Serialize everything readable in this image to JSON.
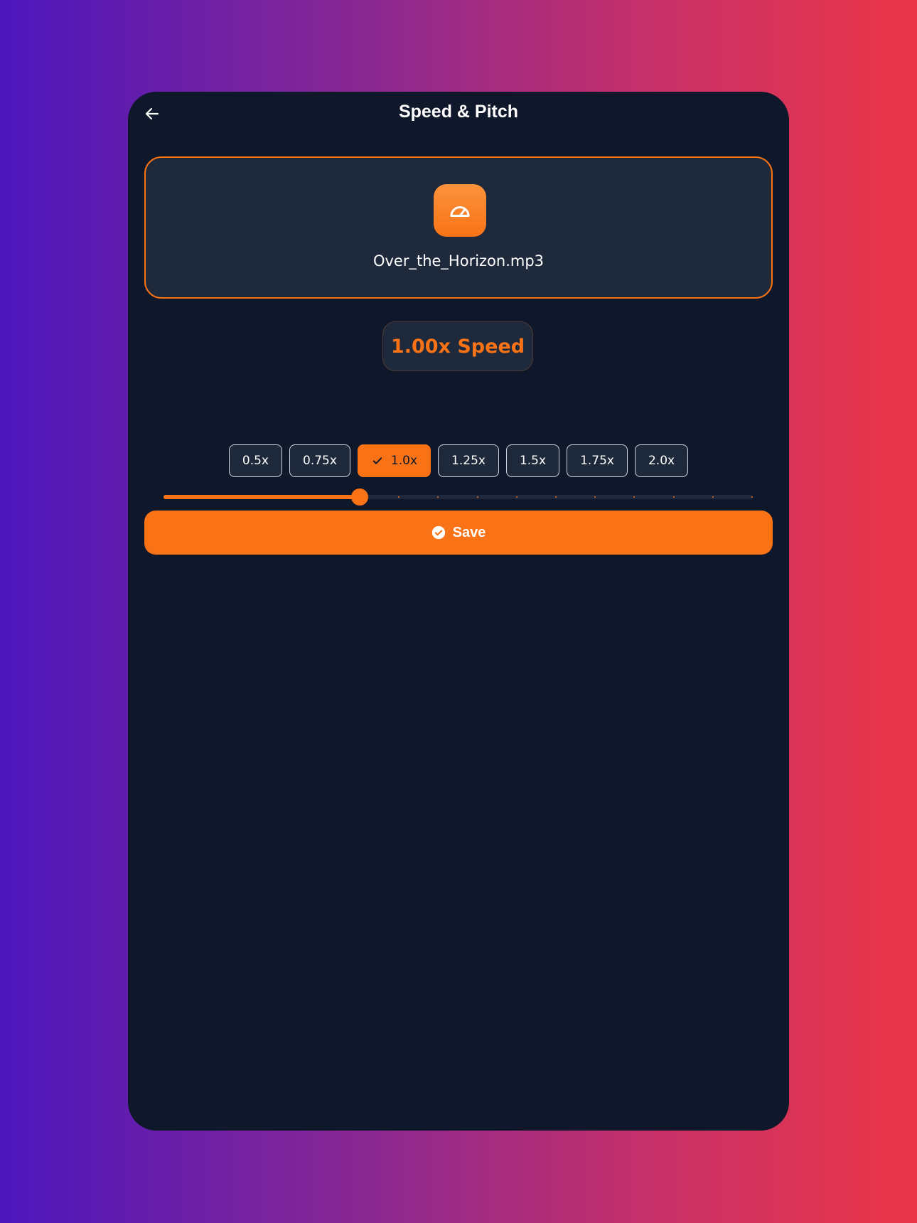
{
  "header": {
    "title": "Speed & Pitch",
    "back_icon": "arrow-left-icon"
  },
  "file": {
    "name": "Over_the_Horizon.mp3",
    "icon": "gauge-icon"
  },
  "speed": {
    "display": "1.00x Speed",
    "value": 1.0,
    "min": 0.5,
    "max": 2.0,
    "step": 0.1
  },
  "presets": [
    {
      "label": "0.5x",
      "selected": false
    },
    {
      "label": "0.75x",
      "selected": false
    },
    {
      "label": "1.0x",
      "selected": true
    },
    {
      "label": "1.25x",
      "selected": false
    },
    {
      "label": "1.5x",
      "selected": false
    },
    {
      "label": "1.75x",
      "selected": false
    },
    {
      "label": "2.0x",
      "selected": false
    }
  ],
  "save": {
    "label": "Save",
    "icon": "check-circle-icon"
  },
  "colors": {
    "accent": "#f97316",
    "background": "#0f172a",
    "card": "#1e293b"
  }
}
